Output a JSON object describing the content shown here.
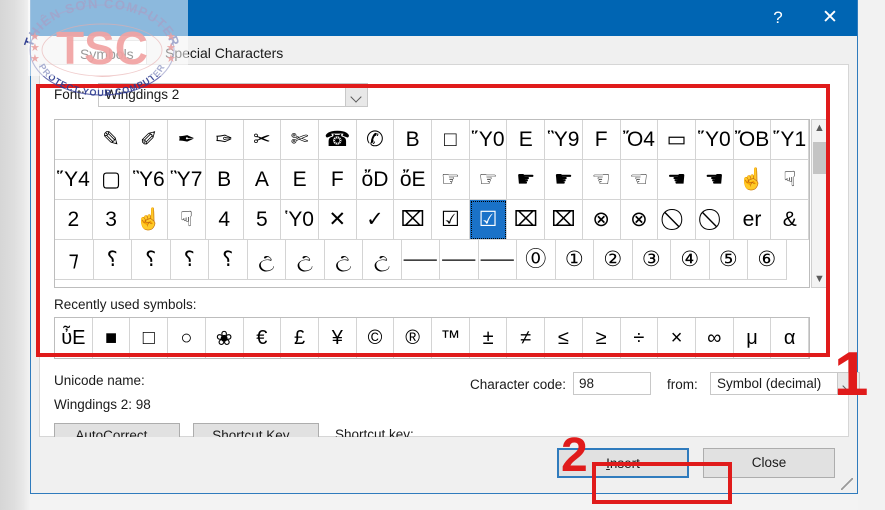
{
  "window": {
    "titlebar_color": "#0065b3",
    "help_button": "?",
    "close_button": "✕"
  },
  "tabs": [
    {
      "label": "Symbols",
      "active": true
    },
    {
      "label": "Special Characters",
      "active": false
    }
  ],
  "font_row": {
    "label": "Font:",
    "value": "Wingdings 2",
    "dropdown_icon": "chevron-down-icon"
  },
  "symbol_grid": {
    "selected_index": 51,
    "rows": [
      [
        "",
        "✎",
        "✐",
        "✒",
        "✑",
        "✂",
        "✄",
        "☎",
        "✆",
        "὜B",
        "□",
        "Ὕ0",
        "὜E",
        "Ὓ9",
        "὜F",
        "Ὄ4",
        "▭",
        "Ὕ0",
        "ὌB",
        "Ὕ1"
      ],
      [
        "Ὕ4",
        "▢",
        "Ὓ6",
        "Ὓ7",
        "὚B",
        "὚A",
        "὚E",
        "὚F",
        "ὄD",
        "ὄE",
        "☞",
        "☞",
        "☛",
        "☛",
        "☜",
        "☜",
        "☚",
        "☚",
        "☝",
        "☟"
      ],
      [
        "὚2",
        "὚3",
        "☝",
        "☟",
        "὚4",
        "὚5",
        "Ὑ0",
        "✕",
        "✓",
        "⌧",
        "☑",
        "☑",
        "⌧",
        "⌧",
        "⊗",
        "⊗",
        "⃠",
        "⃠",
        "er",
        "&"
      ],
      [
        "⁊",
        "⸮",
        "⸮",
        "⸮",
        "⸮",
        "උ",
        "උ",
        "උ",
        "උ",
        "⸺",
        "⸺",
        "⸺",
        "⓪",
        "①",
        "②",
        "③",
        "④",
        "⑤",
        "⑥"
      ]
    ]
  },
  "scrollbar": {
    "up_icon": "chevron-up-icon",
    "down_icon": "chevron-down-icon"
  },
  "recent": {
    "label": "Recently used symbols:",
    "symbols": [
      "ὖE",
      "■",
      "□",
      "○",
      "❀",
      "€",
      "£",
      "¥",
      "©",
      "®",
      "™",
      "±",
      "≠",
      "≤",
      "≥",
      "÷",
      "×",
      "∞",
      "μ",
      "α"
    ]
  },
  "details": {
    "unicode_name_label": "Unicode name:",
    "unicode_name_value": "Wingdings 2: 98",
    "character_code_label": "Character code:",
    "character_code_value": "98",
    "from_label": "from:",
    "from_value": "Symbol (decimal)",
    "autocorrect_button": "AutoCorrect...",
    "shortcut_key_button": "Shortcut Key...",
    "shortcut_key_label": "Shortcut key:"
  },
  "footer": {
    "insert_button": "Insert",
    "close_button": "Close"
  },
  "annotations": {
    "number_1": "1",
    "number_2": "2",
    "color": "#e01b1b"
  },
  "watermark": {
    "top_arc": "THIÊN SƠN COMPUTER",
    "center": "TSC",
    "bottom_arc": "PROTECT YOUR COMPUTER"
  }
}
